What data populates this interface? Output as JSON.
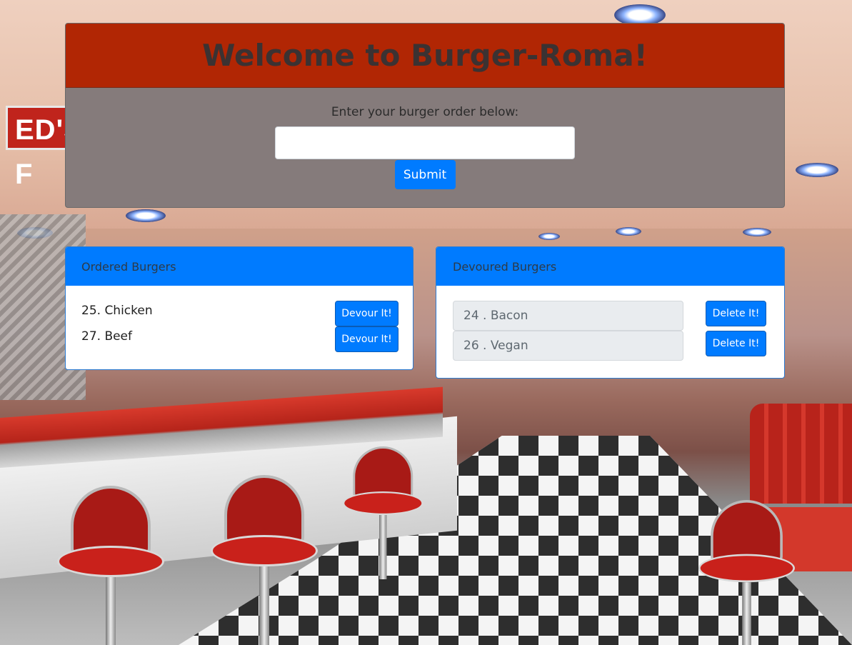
{
  "background": {
    "sign_text": "ED'S F"
  },
  "header": {
    "title": "Welcome to Burger-Roma!",
    "header_color": "#b12604",
    "panel_color": "#857b7b"
  },
  "order_form": {
    "prompt": "Enter your burger order below:",
    "input_value": "",
    "input_placeholder": "",
    "submit_label": "Submit"
  },
  "ordered": {
    "title": "Ordered Burgers",
    "items": [
      {
        "label": "25. Chicken",
        "button": "Devour It!"
      },
      {
        "label": "27. Beef",
        "button": "Devour It!"
      }
    ]
  },
  "devoured": {
    "title": "Devoured Burgers",
    "items": [
      {
        "label": "24 . Bacon",
        "button": "Delete It!"
      },
      {
        "label": "26 . Vegan",
        "button": "Delete It!"
      }
    ]
  },
  "colors": {
    "accent": "#007bff",
    "pill": "#e9ecef"
  }
}
